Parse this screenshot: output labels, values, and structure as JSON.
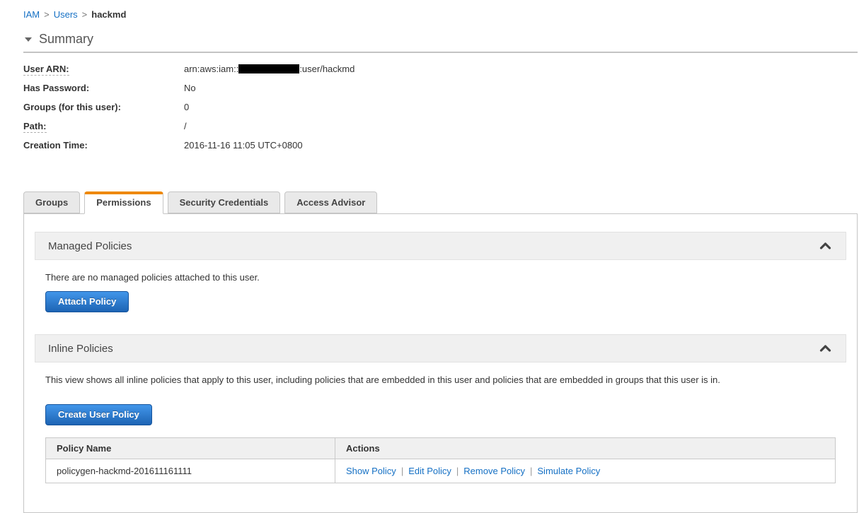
{
  "breadcrumb": {
    "separator": ">",
    "items": [
      {
        "label": "IAM"
      },
      {
        "label": "Users"
      },
      {
        "label": "hackmd"
      }
    ]
  },
  "summary": {
    "title": "Summary",
    "fields": [
      {
        "label": "User ARN:",
        "value_prefix": "arn:aws:iam::",
        "value_redacted": true,
        "value_suffix": ":user/hackmd"
      },
      {
        "label": "Has Password:",
        "value": "No"
      },
      {
        "label": "Groups (for this user):",
        "value": "0"
      },
      {
        "label": "Path:",
        "value": "/"
      },
      {
        "label": "Creation Time:",
        "value": "2016-11-16 11:05 UTC+0800"
      }
    ]
  },
  "tabs": [
    {
      "label": "Groups",
      "active": false
    },
    {
      "label": "Permissions",
      "active": true
    },
    {
      "label": "Security Credentials",
      "active": false
    },
    {
      "label": "Access Advisor",
      "active": false
    }
  ],
  "managed_policies": {
    "title": "Managed Policies",
    "empty_text": "There are no managed policies attached to this user.",
    "attach_button": "Attach Policy"
  },
  "inline_policies": {
    "title": "Inline Policies",
    "description": "This view shows all inline policies that apply to this user, including policies that are embedded in this user and policies that are embedded in groups that this user is in.",
    "create_button": "Create User Policy",
    "table": {
      "headers": [
        "Policy Name",
        "Actions"
      ],
      "action_separator": "|",
      "rows": [
        {
          "policy_name": "policygen-hackmd-201611161111",
          "actions": [
            "Show Policy",
            "Edit Policy",
            "Remove Policy",
            "Simulate Policy"
          ]
        }
      ]
    }
  },
  "icons": {
    "summary_toggle": "triangle-down-icon",
    "managed_collapse": "chevron-up-icon",
    "inline_collapse": "chevron-up-icon"
  },
  "colors": {
    "link_blue": "#1570c4",
    "tab_accent_orange": "#ee8800",
    "button_gradient_top": "#4296ea",
    "button_gradient_bottom": "#1d64b4",
    "section_header_bg": "#f0f0f0",
    "panel_border": "#c5c5c5",
    "redaction": "#000000"
  }
}
